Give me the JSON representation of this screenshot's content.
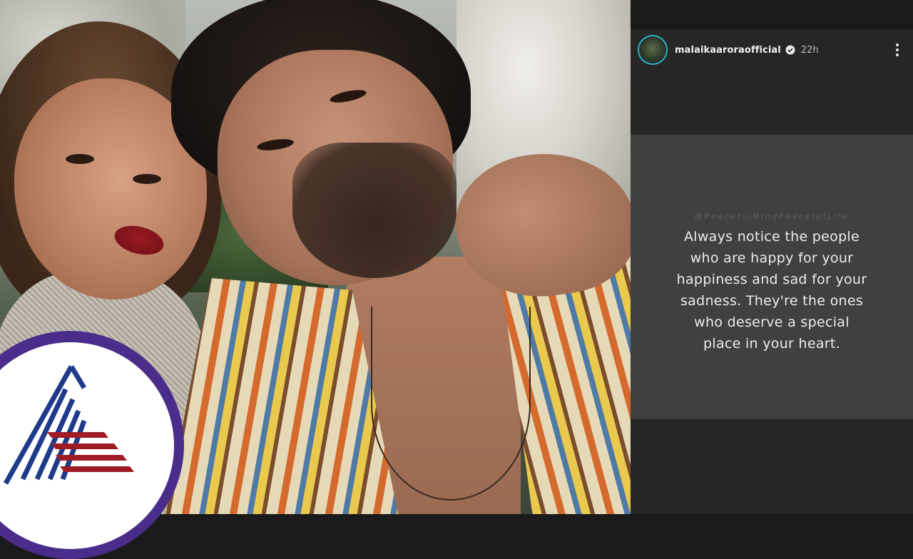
{
  "story": {
    "username": "malaikaaroraofficial",
    "time_ago": "22h",
    "quote_handle": "@PeacefulMindPeacefulLife",
    "quote_lines": [
      "Always notice the people",
      "who are happy for your",
      "happiness and sad for your",
      "sadness. They're the ones",
      "who deserve a special",
      "place in your heart."
    ]
  },
  "colors": {
    "story_background": "#262626",
    "quote_card": "#404040",
    "avatar_ring": "#2bb6c6",
    "logo_ring": "#4a2d8a",
    "logo_stripes_blue": "#1f3a8a",
    "logo_stripes_red": "#a01c24"
  },
  "icons": {
    "verified": "verified-badge-icon",
    "more": "more-vertical-icon",
    "logo": "channel-logo"
  }
}
